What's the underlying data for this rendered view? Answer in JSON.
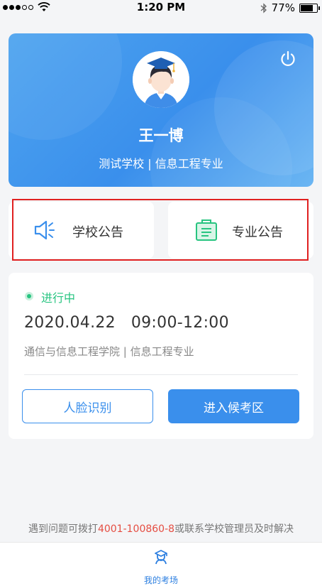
{
  "status_bar": {
    "time": "1:20 PM",
    "battery_text": "77%",
    "battery_level": 0.77
  },
  "profile": {
    "name": "王一博",
    "school_major": "测试学校 | 信息工程专业"
  },
  "notices": {
    "school_label": "学校公告",
    "major_label": "专业公告"
  },
  "exam": {
    "status": "进行中",
    "time": "2020.04.22   09:00-12:00",
    "org": "通信与信息工程学院 | 信息工程专业",
    "face_button": "人脸识别",
    "enter_button": "进入候考区"
  },
  "help": {
    "prefix": "遇到问题可拨打",
    "phone": "4001-100860-8",
    "suffix": "或联系学校管理员及时解决"
  },
  "tab_bar": {
    "items": [
      {
        "label": "我的考场",
        "icon": "exam-hall-icon",
        "active": true
      }
    ]
  },
  "colors": {
    "primary": "#3a8fec",
    "status_green": "#27c480",
    "phone_red": "#e54d42",
    "highlight_frame": "#e02020"
  }
}
